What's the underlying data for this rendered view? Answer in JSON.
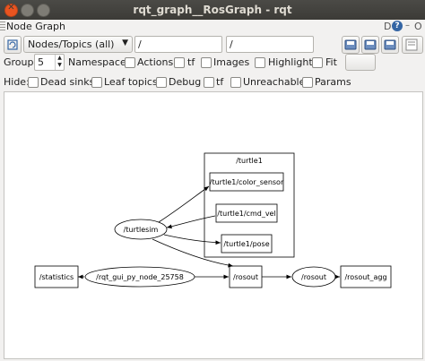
{
  "window": {
    "title": "rqt_graph__RosGraph - rqt"
  },
  "panel": {
    "title": "Node Graph",
    "d_label": "D",
    "help_label": "?",
    "close_label": "O"
  },
  "toolbar": {
    "graph_type": "Nodes/Topics (all)",
    "filter_nodes": "/",
    "filter_topics": "/"
  },
  "options": {
    "group_label": "Group:",
    "group_value": "5",
    "namespaces_label": "Namespaces",
    "actions_label": "Actions",
    "tf_label": "tf",
    "images_label": "Images",
    "highlight_label": "Highlight",
    "fit_label": "Fit"
  },
  "hide": {
    "hide_label": "Hide:",
    "dead_sinks_label": "Dead sinks",
    "leaf_topics_label": "Leaf topics",
    "debug_label": "Debug",
    "tf_label": "tf",
    "unreachable_label": "Unreachable",
    "params_label": "Params"
  },
  "graph": {
    "cluster_label": "/turtle1",
    "nodes": {
      "color_sensor": "/turtle1/color_sensor",
      "cmd_vel": "/turtle1/cmd_vel",
      "pose": "/turtle1/pose",
      "turtlesim": "/turtlesim",
      "statistics": "/statistics",
      "rqt_gui": "/rqt_gui_py_node_25758",
      "rosout_topic": "/rosout",
      "rosout_node": "/rosout",
      "rosout_agg": "/rosout_agg"
    }
  },
  "icons": {
    "refresh": "refresh-icon",
    "save_dot": "save-dot-icon",
    "save_image": "save-image-icon",
    "load": "load-icon",
    "save_svg": "save-svg-icon"
  }
}
